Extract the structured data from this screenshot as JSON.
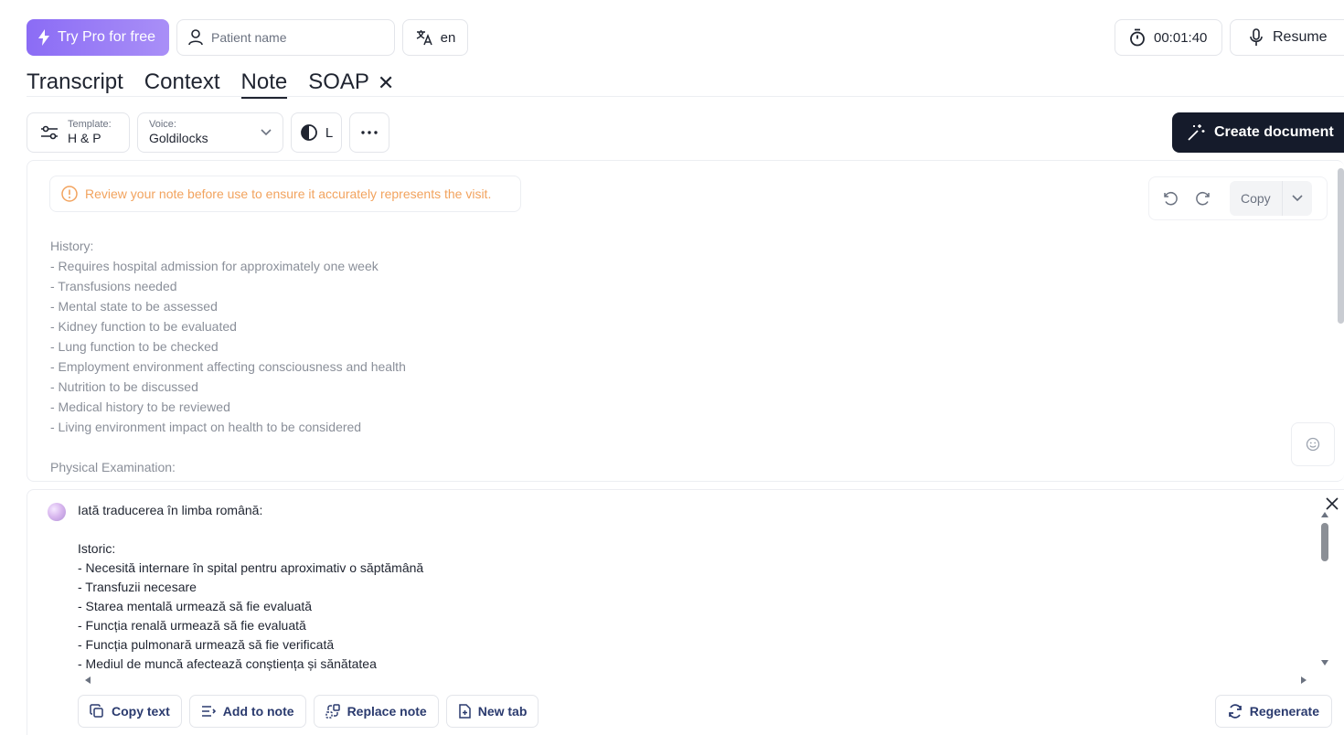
{
  "header": {
    "pro_label": "Try Pro for free",
    "patient_placeholder": "Patient name",
    "language": "en",
    "timer": "00:01:40",
    "resume_label": "Resume"
  },
  "tabs": [
    {
      "label": "Transcript"
    },
    {
      "label": "Context"
    },
    {
      "label": "Note",
      "active": true
    },
    {
      "label": "SOAP"
    }
  ],
  "tab_close": "✕",
  "toolbar": {
    "template_label": "Template:",
    "template_value": "H & P",
    "voice_label": "Voice:",
    "voice_value": "Goldilocks",
    "contrast_label": "L",
    "create_label": "Create document"
  },
  "note": {
    "warning": "Review your note before use to ensure it accurately represents the visit.",
    "copy_label": "Copy",
    "lines": [
      "History:",
      "- Requires hospital admission for approximately one week",
      "- Transfusions needed",
      "- Mental state to be assessed",
      "- Kidney function to be evaluated",
      "- Lung function to be checked",
      "- Employment environment affecting consciousness and health",
      "- Nutrition to be discussed",
      "- Medical history to be reviewed",
      "- Living environment impact on health to be considered",
      "",
      "Physical Examination:"
    ]
  },
  "translation": {
    "lines": [
      "Iată traducerea în limba română:",
      "",
      "Istoric:",
      "- Necesită internare în spital pentru aproximativ o săptămână",
      "- Transfuzii necesare",
      "- Starea mentală urmează să fie evaluată",
      "- Funcția renală urmează să fie evaluată",
      "- Funcția pulmonară urmează să fie verificată",
      "- Mediul de muncă afectează conștiența și sănătatea"
    ],
    "actions": {
      "copy_text": "Copy text",
      "add_to_note": "Add to note",
      "replace_note": "Replace note",
      "new_tab": "New tab",
      "regenerate": "Regenerate"
    }
  },
  "colors": {
    "pro_gradient_start": "#8b6cf5",
    "create_bg": "#151b2b",
    "warning": "#f2a35e",
    "action_text": "#2a3a6e"
  }
}
